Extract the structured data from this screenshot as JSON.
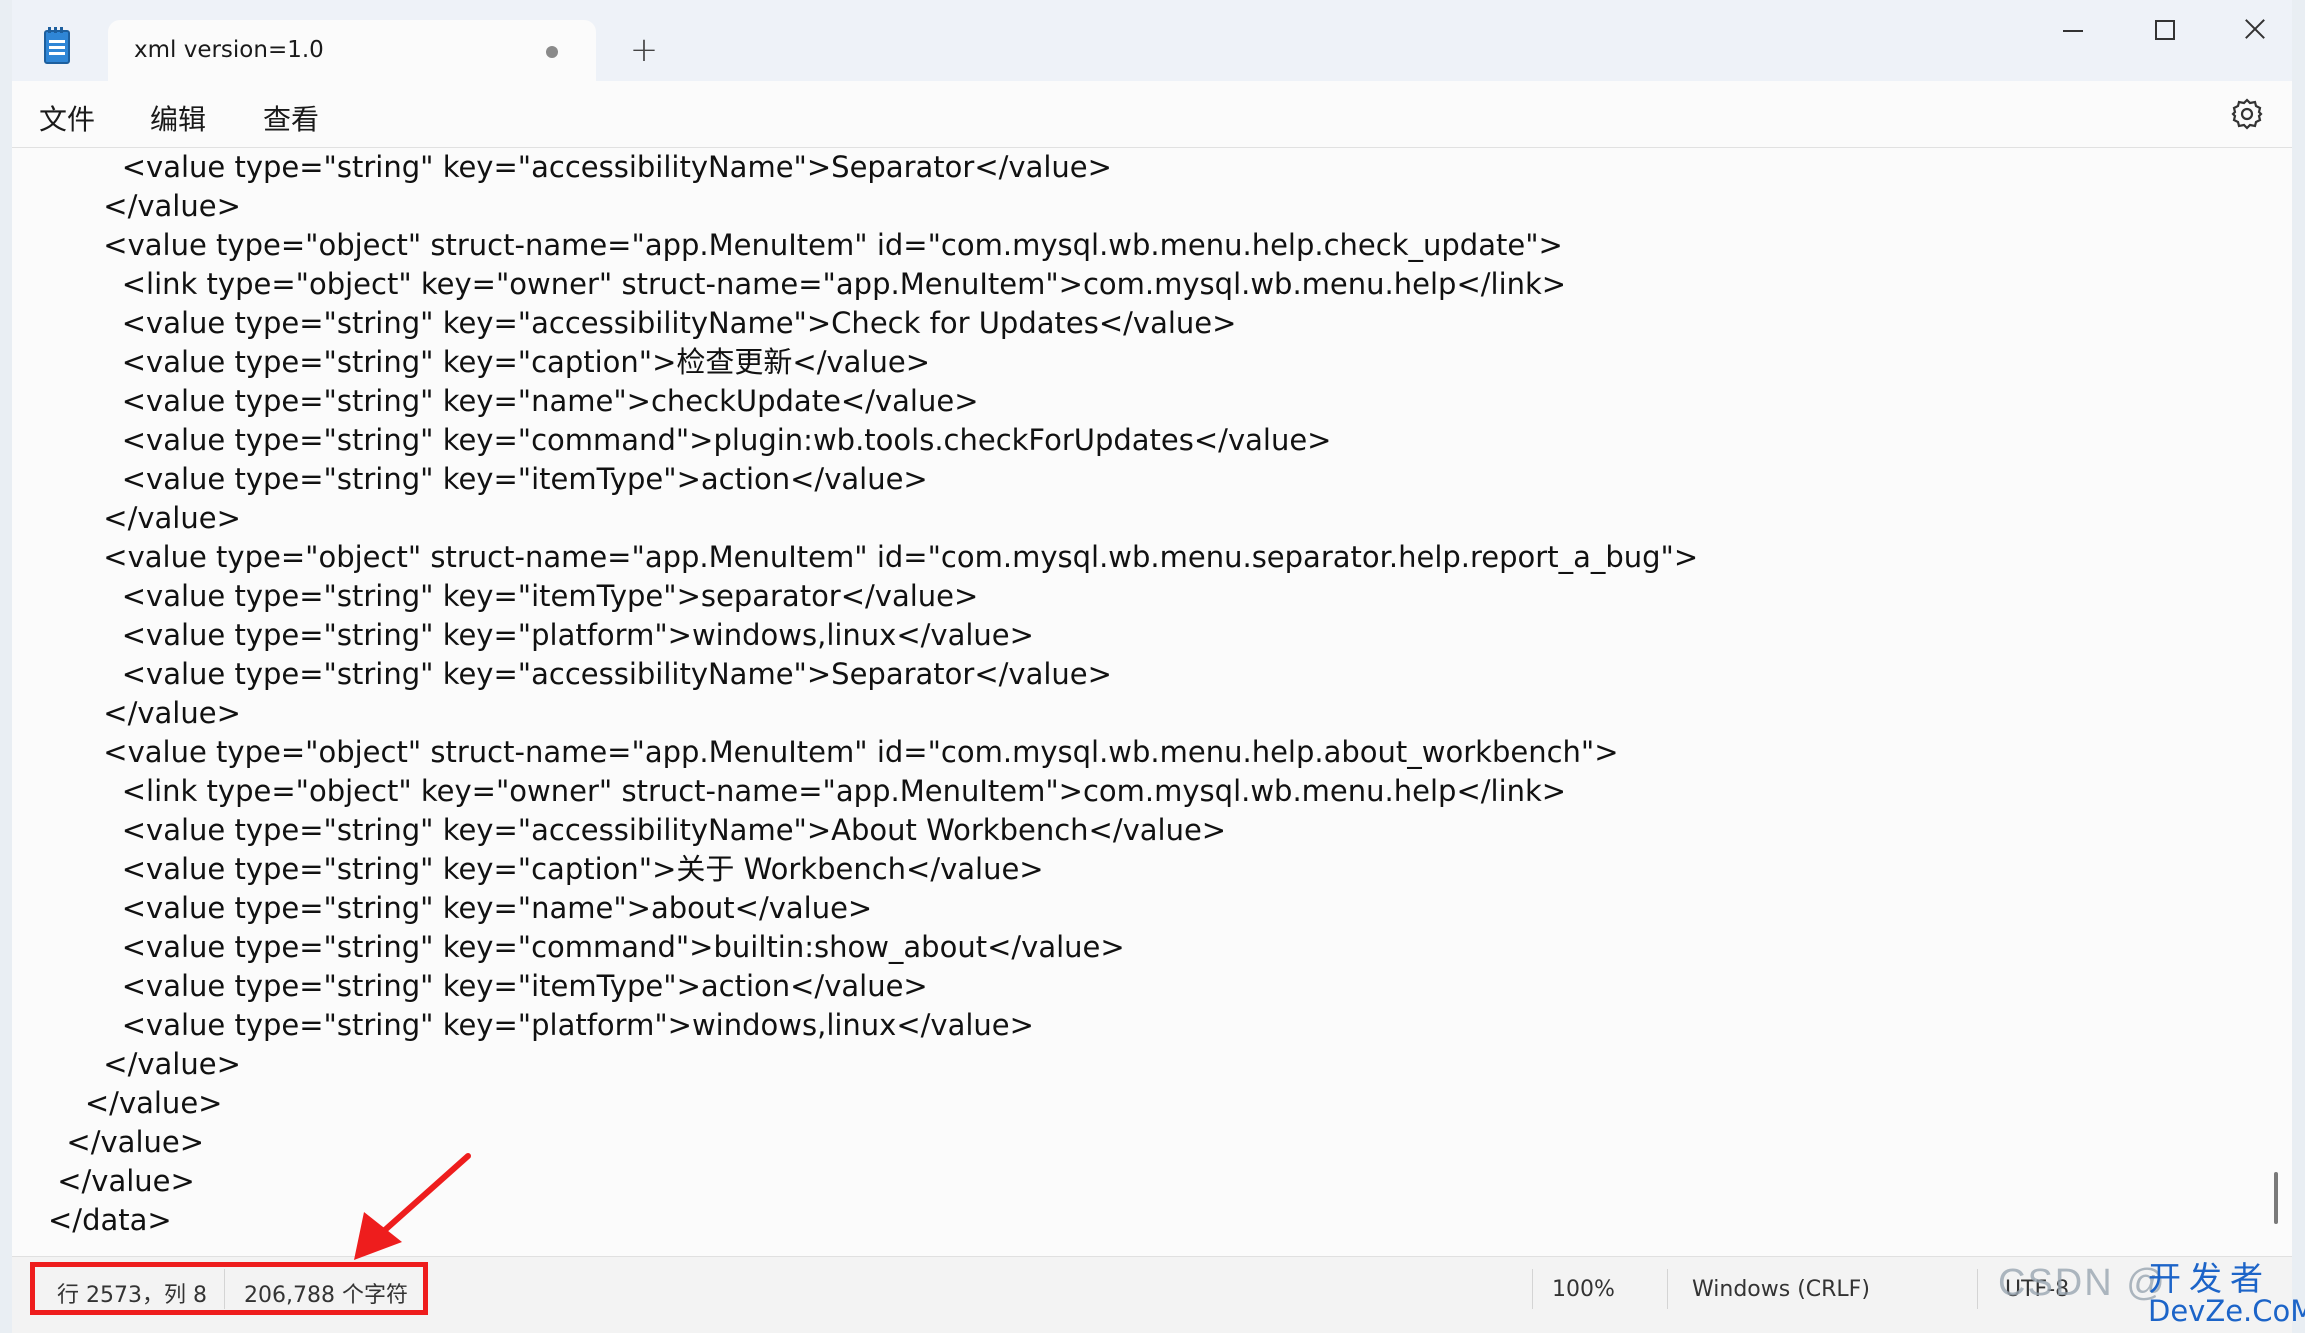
{
  "window": {
    "tab_title": "xml version=1.0",
    "new_tab_symbol": "+"
  },
  "menu": {
    "file": "文件",
    "edit": "编辑",
    "view": "查看"
  },
  "editor": {
    "lines": [
      "        <value type=\"string\" key=\"accessibilityName\">Separator</value>",
      "      </value>",
      "      <value type=\"object\" struct-name=\"app.MenuItem\" id=\"com.mysql.wb.menu.help.check_update\">",
      "        <link type=\"object\" key=\"owner\" struct-name=\"app.MenuItem\">com.mysql.wb.menu.help</link>",
      "        <value type=\"string\" key=\"accessibilityName\">Check for Updates</value>",
      "        <value type=\"string\" key=\"caption\">检查更新</value>",
      "        <value type=\"string\" key=\"name\">checkUpdate</value>",
      "        <value type=\"string\" key=\"command\">plugin:wb.tools.checkForUpdates</value>",
      "        <value type=\"string\" key=\"itemType\">action</value>",
      "      </value>",
      "      <value type=\"object\" struct-name=\"app.MenuItem\" id=\"com.mysql.wb.menu.separator.help.report_a_bug\">",
      "        <value type=\"string\" key=\"itemType\">separator</value>",
      "        <value type=\"string\" key=\"platform\">windows,linux</value>",
      "        <value type=\"string\" key=\"accessibilityName\">Separator</value>",
      "      </value>",
      "      <value type=\"object\" struct-name=\"app.MenuItem\" id=\"com.mysql.wb.menu.help.about_workbench\">",
      "        <link type=\"object\" key=\"owner\" struct-name=\"app.MenuItem\">com.mysql.wb.menu.help</link>",
      "        <value type=\"string\" key=\"accessibilityName\">About Workbench</value>",
      "        <value type=\"string\" key=\"caption\">关于 Workbench</value>",
      "        <value type=\"string\" key=\"name\">about</value>",
      "        <value type=\"string\" key=\"command\">builtin:show_about</value>",
      "        <value type=\"string\" key=\"itemType\">action</value>",
      "        <value type=\"string\" key=\"platform\">windows,linux</value>",
      "      </value>",
      "    </value>",
      "  </value>",
      " </value>",
      "</data>"
    ]
  },
  "status": {
    "position": "行 2573，列 8",
    "characters": "206,788 个字符",
    "zoom": "100%",
    "line_ending": "Windows (CRLF)",
    "encoding": "UTF-8"
  },
  "watermark": {
    "csdn": "CSDN @",
    "brand_cn": "开发者",
    "brand_en": "DevZe.CoM"
  },
  "colors": {
    "highlight": "#ee1d1d",
    "brand": "#1c64c8"
  },
  "icons": {
    "app": "notepad-icon",
    "settings": "gear-icon"
  }
}
